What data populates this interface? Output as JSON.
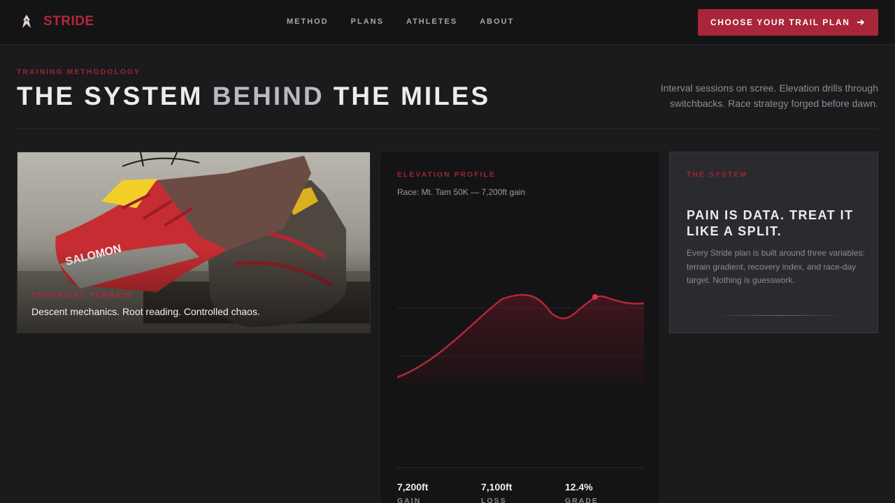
{
  "brand": {
    "name": "STRIDE",
    "icon": "runner-flame-icon",
    "color": "#b3273a"
  },
  "nav": {
    "links": [
      "METHOD",
      "PLANS",
      "ATHLETES",
      "ABOUT"
    ],
    "cta_label": "CHOOSE YOUR TRAIL PLAN",
    "cta_icon": "arrow-right-icon",
    "cta_color": "#a8253a"
  },
  "hero": {
    "eyebrow": "TRAINING METHODOLOGY",
    "title_part1": "THE SYSTEM",
    "title_accent": "BEHIND",
    "title_part2": "THE MILES",
    "description": "Interval sessions on scree. Elevation drills through switchbacks. Race strategy forged before dawn."
  },
  "cards": {
    "photo": {
      "eyebrow": "TECHNICAL TERRAIN",
      "caption": "Descent mechanics. Root reading. Controlled chaos.",
      "shoe_brand": "SALOMON"
    },
    "elevation": {
      "eyebrow": "ELEVATION PROFILE",
      "subtitle": "Race: Mt. Tam 50K — 7,200ft gain",
      "stats": [
        {
          "value": "7,200ft",
          "label": "GAIN"
        },
        {
          "value": "7,100ft",
          "label": "LOSS"
        },
        {
          "value": "12.4%",
          "label": "GRADE"
        }
      ]
    },
    "system": {
      "eyebrow": "THE SYSTEM",
      "title": "PAIN IS DATA. TREAT IT LIKE A SPLIT.",
      "body": "Every Stride plan is built around three variables: terrain gradient, recovery index, and race-day target. Nothing is guesswork."
    }
  }
}
